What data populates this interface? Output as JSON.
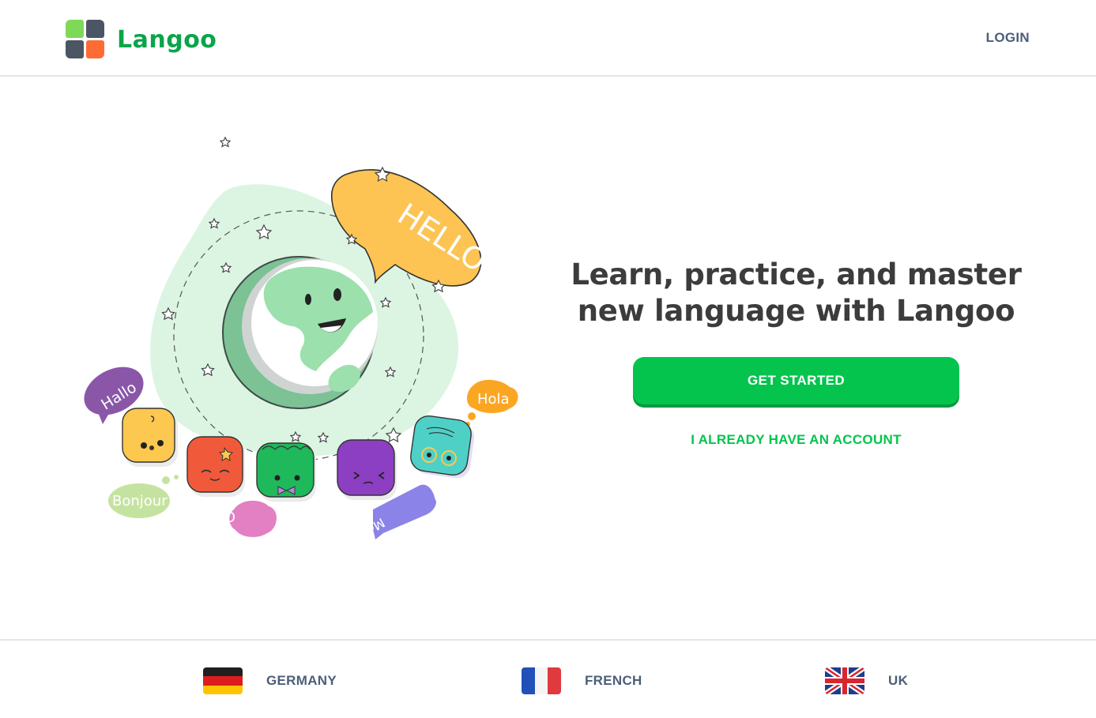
{
  "header": {
    "brand": "Langoo",
    "login_label": "LOGIN"
  },
  "hero": {
    "title": "Learn, practice, and master new language with Langoo",
    "primary_cta": "GET STARTED",
    "secondary_cta": "I ALREADY HAVE AN ACCOUNT",
    "illustration_words": {
      "hello": "HELLO",
      "hallo": "Hallo",
      "hola": "Hola",
      "bonjour": "Bonjour",
      "ciao": "Ciao",
      "merhaba": "Merhaba"
    }
  },
  "footer": {
    "languages": [
      {
        "label": "GERMANY",
        "flag": "germany-flag-icon"
      },
      {
        "label": "FRENCH",
        "flag": "france-flag-icon"
      },
      {
        "label": "UK",
        "flag": "uk-flag-icon"
      }
    ]
  },
  "colors": {
    "brand_green": "#0aa54a",
    "cta_green": "#04c44e",
    "nav_text": "#4b5f78",
    "logo_light_green": "#7ed957",
    "logo_dark": "#4b5563",
    "logo_orange": "#ff6b35"
  }
}
